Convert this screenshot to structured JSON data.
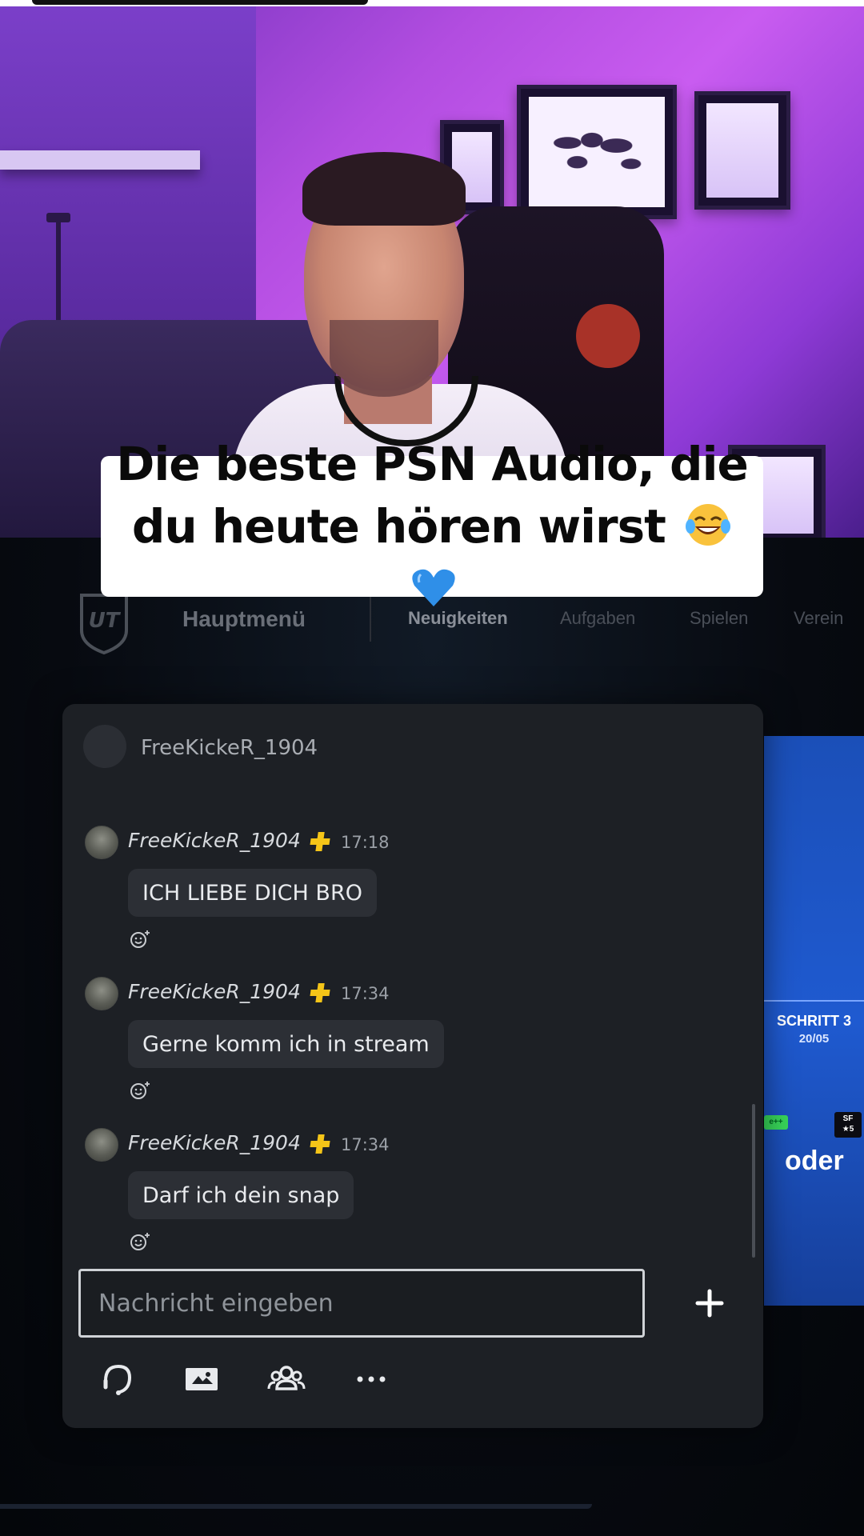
{
  "caption": {
    "text": "Die beste PSN Audio, die du heute hören wirst",
    "emojis": [
      "face-with-tears-of-joy-icon",
      "blue-heart-icon"
    ]
  },
  "menu": {
    "title": "Hauptmenü",
    "tabs": [
      "Neuigkeiten",
      "Aufgaben",
      "Spielen",
      "Verein"
    ],
    "active_tab": "Neuigkeiten"
  },
  "promo": {
    "step": "SCHRITT 3",
    "date": "20/05",
    "word": "oder",
    "chip_left": "e++",
    "chip_right_line1": "SF",
    "chip_right_line2": "★5"
  },
  "chat": {
    "header_name": "FreeKickeR_1904",
    "messages": [
      {
        "user": "FreeKickeR_1904",
        "time": "17:18",
        "text": "ICH LIEBE DICH BRO"
      },
      {
        "user": "FreeKickeR_1904",
        "time": "17:34",
        "text": "Gerne komm ich in stream"
      },
      {
        "user": "FreeKickeR_1904",
        "time": "17:34",
        "text": "Darf ich dein snap"
      }
    ],
    "input_placeholder": "Nachricht eingeben",
    "toolbar": [
      "headset-icon",
      "share-screen-icon",
      "group-icon",
      "more-icon"
    ]
  },
  "colors": {
    "plus_badge": "#f5c518",
    "panel": "#1d2025",
    "bubble": "#2c2f35"
  }
}
